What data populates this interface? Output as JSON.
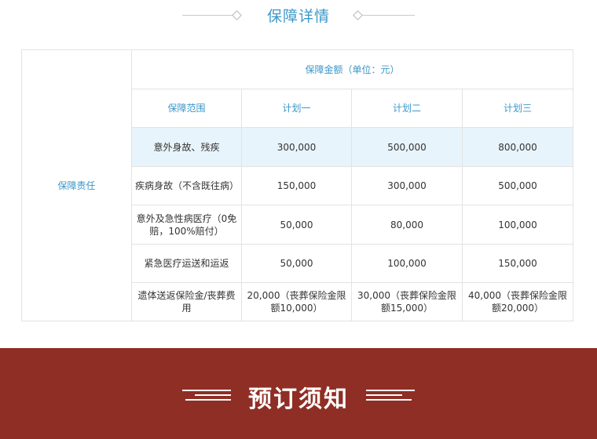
{
  "section": {
    "title": "保障详情"
  },
  "table": {
    "row_header": "保障责任",
    "amount_header": "保障金额（单位：元）",
    "scope_header": "保障范围",
    "plans": [
      "计划一",
      "计划二",
      "计划三"
    ],
    "rows": [
      {
        "label": "意外身故、残疾",
        "values": [
          "300,000",
          "500,000",
          "800,000"
        ]
      },
      {
        "label": "疾病身故（不含既往病）",
        "values": [
          "150,000",
          "300,000",
          "500,000"
        ]
      },
      {
        "label": "意外及急性病医疗（0免赔，100%赔付）",
        "values": [
          "50,000",
          "80,000",
          "100,000"
        ]
      },
      {
        "label": "紧急医疗运送和运返",
        "values": [
          "50,000",
          "100,000",
          "150,000"
        ]
      },
      {
        "label": "遗体送返保险金/丧葬费用",
        "values": [
          "20,000（丧葬保险金限额10,000）",
          "30,000（丧葬保险金限额15,000）",
          "40,000（丧葬保险金限额20,000）"
        ]
      }
    ]
  },
  "notice": {
    "title": "预订须知"
  },
  "colors": {
    "accent": "#3b97c9",
    "highlight_row": "#e8f4fb",
    "footer_bg": "#8f2e25"
  }
}
